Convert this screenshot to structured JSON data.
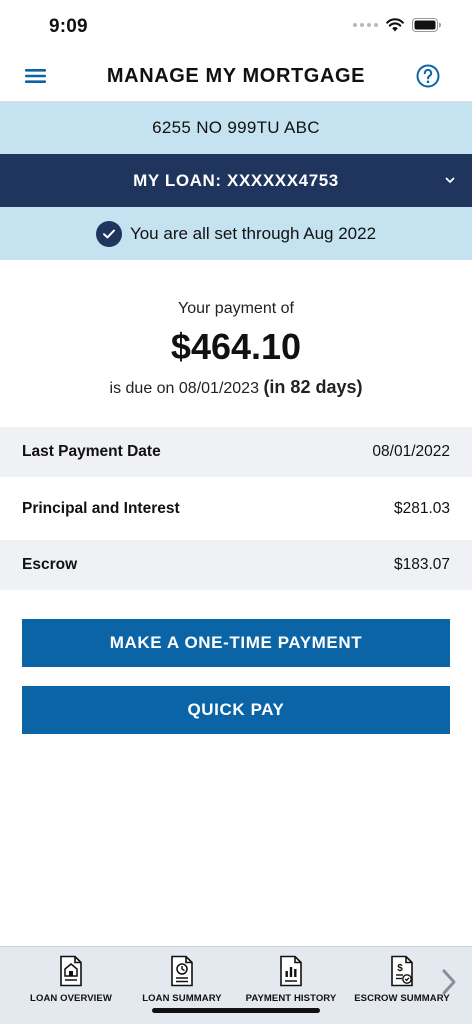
{
  "status_bar": {
    "time": "9:09"
  },
  "header": {
    "title": "MANAGE MY MORTGAGE"
  },
  "property": {
    "address": "6255 NO 999TU ABC"
  },
  "loan": {
    "label": "MY LOAN: XXXXXX4753"
  },
  "status_banner": {
    "message": "You are all set through Aug 2022"
  },
  "payment": {
    "intro": "Your payment of",
    "amount": "$464.10",
    "due_prefix": "is due on 08/01/2023",
    "due_days": "(in 82 days)"
  },
  "details": [
    {
      "label": "Last Payment Date",
      "value": "08/01/2022"
    },
    {
      "label": "Principal and Interest",
      "value": "$281.03"
    },
    {
      "label": "Escrow",
      "value": "$183.07"
    }
  ],
  "actions": {
    "one_time_payment": "MAKE A ONE-TIME PAYMENT",
    "quick_pay": "QUICK PAY"
  },
  "bottom_nav": [
    {
      "label": "LOAN OVERVIEW",
      "icon": "house-document-icon"
    },
    {
      "label": "LOAN SUMMARY",
      "icon": "clock-document-icon"
    },
    {
      "label": "PAYMENT HISTORY",
      "icon": "chart-document-icon"
    },
    {
      "label": "ESCROW SUMMARY",
      "icon": "dollar-document-icon"
    }
  ],
  "colors": {
    "navy": "#1f355e",
    "light_blue": "#c5e2f0",
    "action_blue": "#0a64a6",
    "row_shade": "#eff1f5"
  }
}
